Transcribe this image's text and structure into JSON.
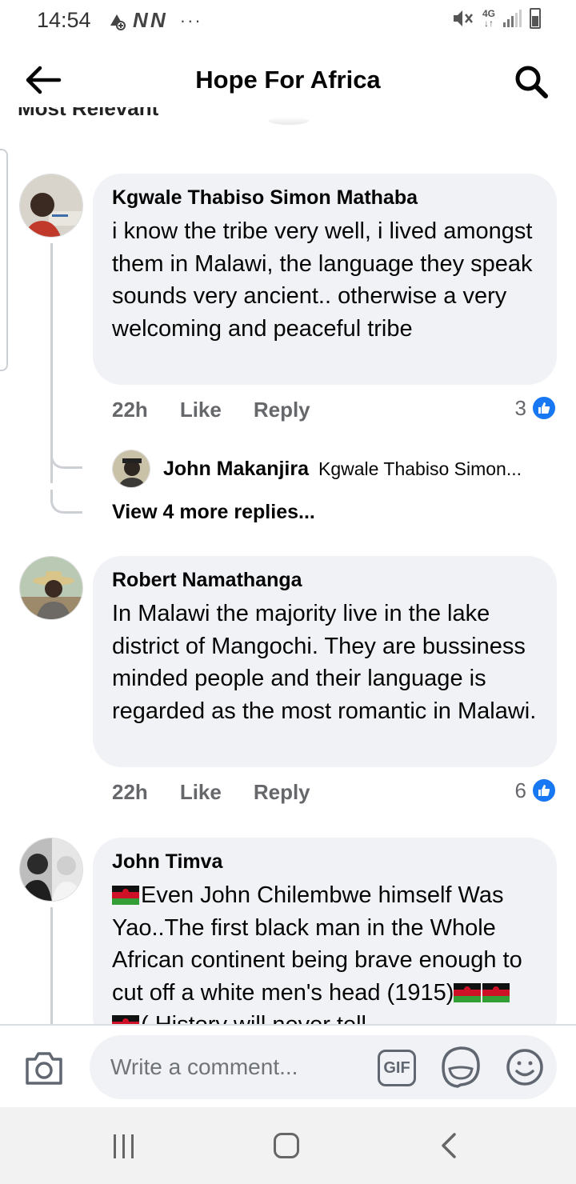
{
  "status_bar": {
    "time": "14:54",
    "network": "4G",
    "n_icons": "N N",
    "more": "···"
  },
  "header": {
    "title": "Hope For Africa",
    "back_icon": "back-arrow-icon",
    "search_icon": "search-icon"
  },
  "sort": {
    "label": "Most Relevant"
  },
  "comments": [
    {
      "author": "Kgwale Thabiso Simon Mathaba",
      "text": "i know the tribe very well, i lived amongst them in Malawi, the language they speak sounds very ancient.. otherwise a very welcoming and peaceful tribe",
      "time": "22h",
      "like_label": "Like",
      "reply_label": "Reply",
      "reactions": "3"
    },
    {
      "author": "Robert Namathanga",
      "text": "In Malawi the majority live in the lake district of Mangochi. They are bussiness minded people and their language is regarded as the most romantic in Malawi.",
      "time": "22h",
      "like_label": "Like",
      "reply_label": "Reply",
      "reactions": "6"
    },
    {
      "author": "John Timva",
      "text_line1": "Even John Chilembwe himself",
      "text_rest": "Was Yao..The first black man in  the Whole African continent being brave enough to cut off a white men's head (1915)",
      "text_tail": "( History will never tell"
    }
  ],
  "reply_preview": {
    "author": "John Makanjira",
    "snippet": "Kgwale Thabiso Simon..."
  },
  "view_more": "View 4 more replies...",
  "composer": {
    "placeholder": "Write a comment...",
    "gif_label": "GIF"
  },
  "colors": {
    "bubble": "#f0f2f5",
    "like_blue": "#1877f2",
    "meta_gray": "#65676b"
  }
}
